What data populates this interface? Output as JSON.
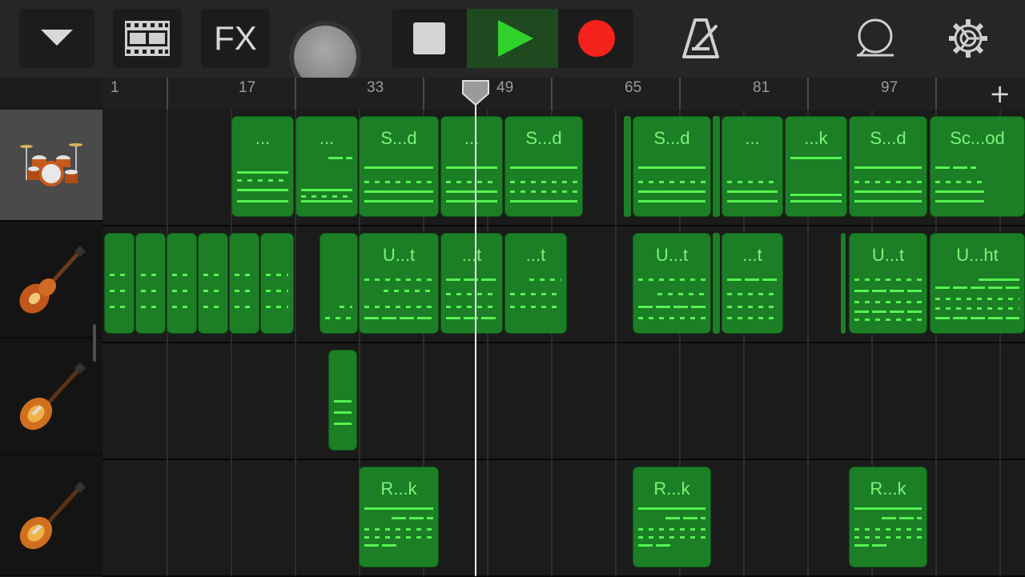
{
  "toolbar": {
    "browser_icon": "chevron-down-icon",
    "tracks_view_icon": "tracks-view-icon",
    "fx_label": "FX",
    "volume_icon": "volume-knob",
    "stop_icon": "stop-icon",
    "play_icon": "play-icon",
    "record_icon": "record-icon",
    "metronome_icon": "metronome-icon",
    "loops_icon": "loop-browser-icon",
    "settings_icon": "gear-icon",
    "colors": {
      "play": "#31d12c",
      "record": "#f5221b",
      "region": "#1c7f26",
      "notes": "#55f350"
    }
  },
  "ruler": {
    "bars": [
      "1",
      "17",
      "33",
      "49",
      "65",
      "81",
      "97"
    ],
    "add_label": "+"
  },
  "tracks": [
    {
      "instrument": "drum-kit",
      "selected": true,
      "regions": [
        {
          "label": "..."
        },
        {
          "label": "..."
        },
        {
          "label": "S...d"
        },
        {
          "label": "..."
        },
        {
          "label": "S...d"
        },
        {
          "label": "S...d"
        },
        {
          "label": "..."
        },
        {
          "label": "...k"
        },
        {
          "label": "S...d"
        },
        {
          "label": "Sc...od"
        }
      ]
    },
    {
      "instrument": "bass-guitar",
      "selected": false,
      "regions": [
        {
          "label": ""
        },
        {
          "label": ""
        },
        {
          "label": "U...t"
        },
        {
          "label": "...t"
        },
        {
          "label": "...t"
        },
        {
          "label": "U...t"
        },
        {
          "label": "...t"
        },
        {
          "label": "U...t"
        },
        {
          "label": "U...ht"
        }
      ]
    },
    {
      "instrument": "electric-guitar",
      "selected": false,
      "regions": [
        {
          "label": ""
        }
      ]
    },
    {
      "instrument": "electric-guitar",
      "selected": false,
      "regions": [
        {
          "label": "R...k"
        },
        {
          "label": "R...k"
        },
        {
          "label": "R...k"
        }
      ]
    }
  ],
  "playhead": {
    "bar": 47
  }
}
